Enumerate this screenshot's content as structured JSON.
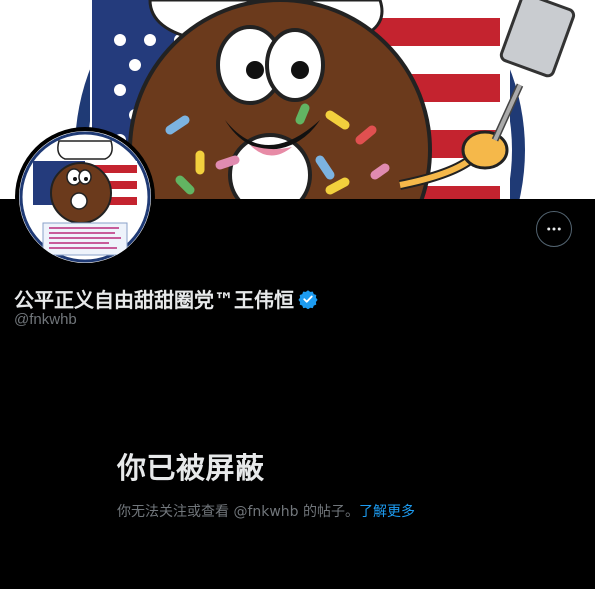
{
  "profile": {
    "display_name": "公平正义自由甜甜圈党™王伟恒",
    "handle": "@fnkwhb",
    "verified": true
  },
  "blocked": {
    "title": "你已被屏蔽",
    "description": "你无法关注或查看 @fnkwhb 的帖子。",
    "learn_more": "了解更多"
  },
  "icons": {
    "more": "more-horizontal-icon",
    "verified": "verified-badge-icon"
  },
  "colors": {
    "background": "#000000",
    "accent": "#1d9bf0",
    "secondary_text": "#71767b"
  }
}
